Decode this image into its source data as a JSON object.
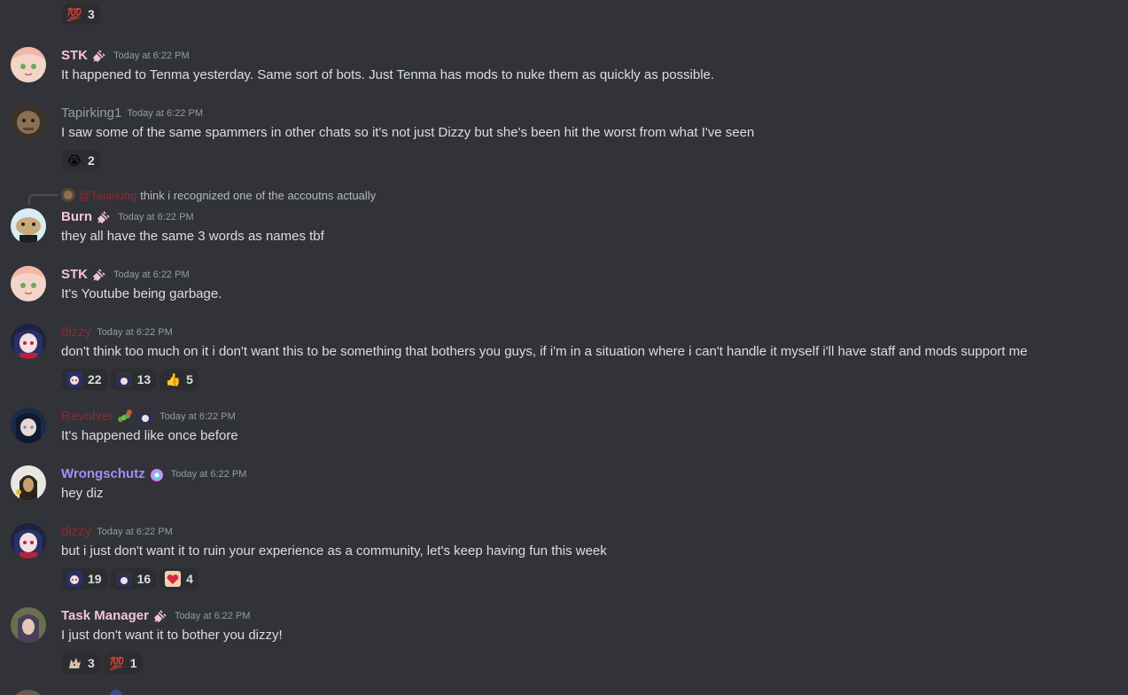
{
  "top_reaction": {
    "emoji": "💯",
    "count": "3"
  },
  "messages": [
    {
      "user": "STK",
      "time": "Today at 6:22 PM",
      "text": "It happened to Tenma yesterday.  Same sort of bots.  Just Tenma has mods to nuke them as quickly as possible."
    },
    {
      "user": "Tapirking1",
      "time": "Today at 6:22 PM",
      "text": "I saw some of the same spammers in other chats so it's not just Dizzy but she's been hit the worst from what I've seen",
      "reactions": [
        {
          "emoji": "😭",
          "count": "2"
        }
      ]
    },
    {
      "reply": {
        "name": "@Tapirking",
        "text": "think i recognized one of the accoutns actually"
      },
      "user": "Burn",
      "time": "Today at 6:22 PM",
      "text": "they all have the same 3 words as names tbf"
    },
    {
      "user": "STK",
      "time": "Today at 6:22 PM",
      "text": "It's Youtube being garbage."
    },
    {
      "user": "dizzy",
      "time": "Today at 6:22 PM",
      "text": "don't think too much on it i don't want this to be something that bothers you guys, if i'm in a situation where i can't handle it myself i'll have staff and mods support me",
      "reactions": [
        {
          "emoji": "dizzy-emote",
          "count": "22"
        },
        {
          "emoji": "dizzy-emote-2",
          "count": "13"
        },
        {
          "emoji": "👍",
          "count": "5"
        }
      ]
    },
    {
      "user": "Revolver",
      "time": "Today at 6:22 PM",
      "text": "It's happened like once before"
    },
    {
      "user": "Wrongschutz",
      "time": "Today at 6:22 PM",
      "text": "hey diz"
    },
    {
      "user": "dizzy",
      "time": "Today at 6:22 PM",
      "text": "but i just don't want it to ruin your experience as a community, let's keep having fun this week",
      "reactions": [
        {
          "emoji": "dizzy-emote",
          "count": "19"
        },
        {
          "emoji": "dizzy-emote-2",
          "count": "16"
        },
        {
          "emoji": "heart-emote",
          "count": "4"
        }
      ]
    },
    {
      "user": "Task Manager",
      "time": "Today at 6:22 PM",
      "text": "I just don't want it to bother you dizzy!",
      "reactions": [
        {
          "emoji": "cat-emote",
          "count": "3"
        },
        {
          "emoji": "💯",
          "count": "1"
        }
      ]
    }
  ],
  "colors": {
    "background": "#313338",
    "pink_name": "#f5c3dd",
    "red_name": "#8c2a33",
    "purple_name": "#a78bfa",
    "gray_name": "#949ba4",
    "text": "#dbdee1",
    "timestamp": "#949ba4"
  }
}
